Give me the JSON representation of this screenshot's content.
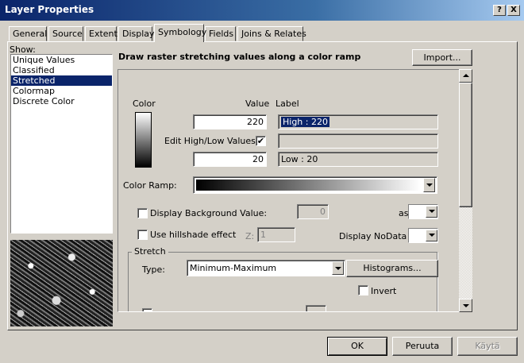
{
  "window": {
    "title": "Layer Properties",
    "help_btn": "?",
    "close_btn": "X"
  },
  "tabs": [
    "General",
    "Source",
    "Extent",
    "Display",
    "Symbology",
    "Fields",
    "Joins & Relates"
  ],
  "active_tab": "Symbology",
  "show_label": "Show:",
  "show_items": [
    "Unique Values",
    "Classified",
    "Stretched",
    "Colormap",
    "Discrete Color"
  ],
  "selected_item": "Stretched",
  "header_text": "Draw raster stretching values along a color ramp",
  "import_button": "Import...",
  "color_header": "Color",
  "value_header": "Value",
  "label_header": "Label",
  "high_value": "220",
  "high_label": "High : 220",
  "edit_highlow_label": "Edit High/Low Values",
  "edit_highlow_checked": true,
  "mid_label": "",
  "low_value": "20",
  "low_label": "Low : 20",
  "color_ramp_label": "Color Ramp:",
  "display_bg_label": "Display Background Value:",
  "display_bg_value": "0",
  "as_label": "as",
  "hillshade_label": "Use hillshade effect",
  "z_label": "Z:",
  "z_value": "1",
  "nodata_label": "Display NoData as",
  "stretch_group": "Stretch",
  "type_label": "Type:",
  "type_value": "Minimum-Maximum",
  "histograms_button": "Histograms...",
  "invert_label": "Invert",
  "ok_button": "OK",
  "cancel_button": "Peruuta",
  "apply_button": "Käytä",
  "colors": {
    "titlebar": "#0a246a",
    "face": "#d4d0c8",
    "selection": "#0a246a"
  }
}
